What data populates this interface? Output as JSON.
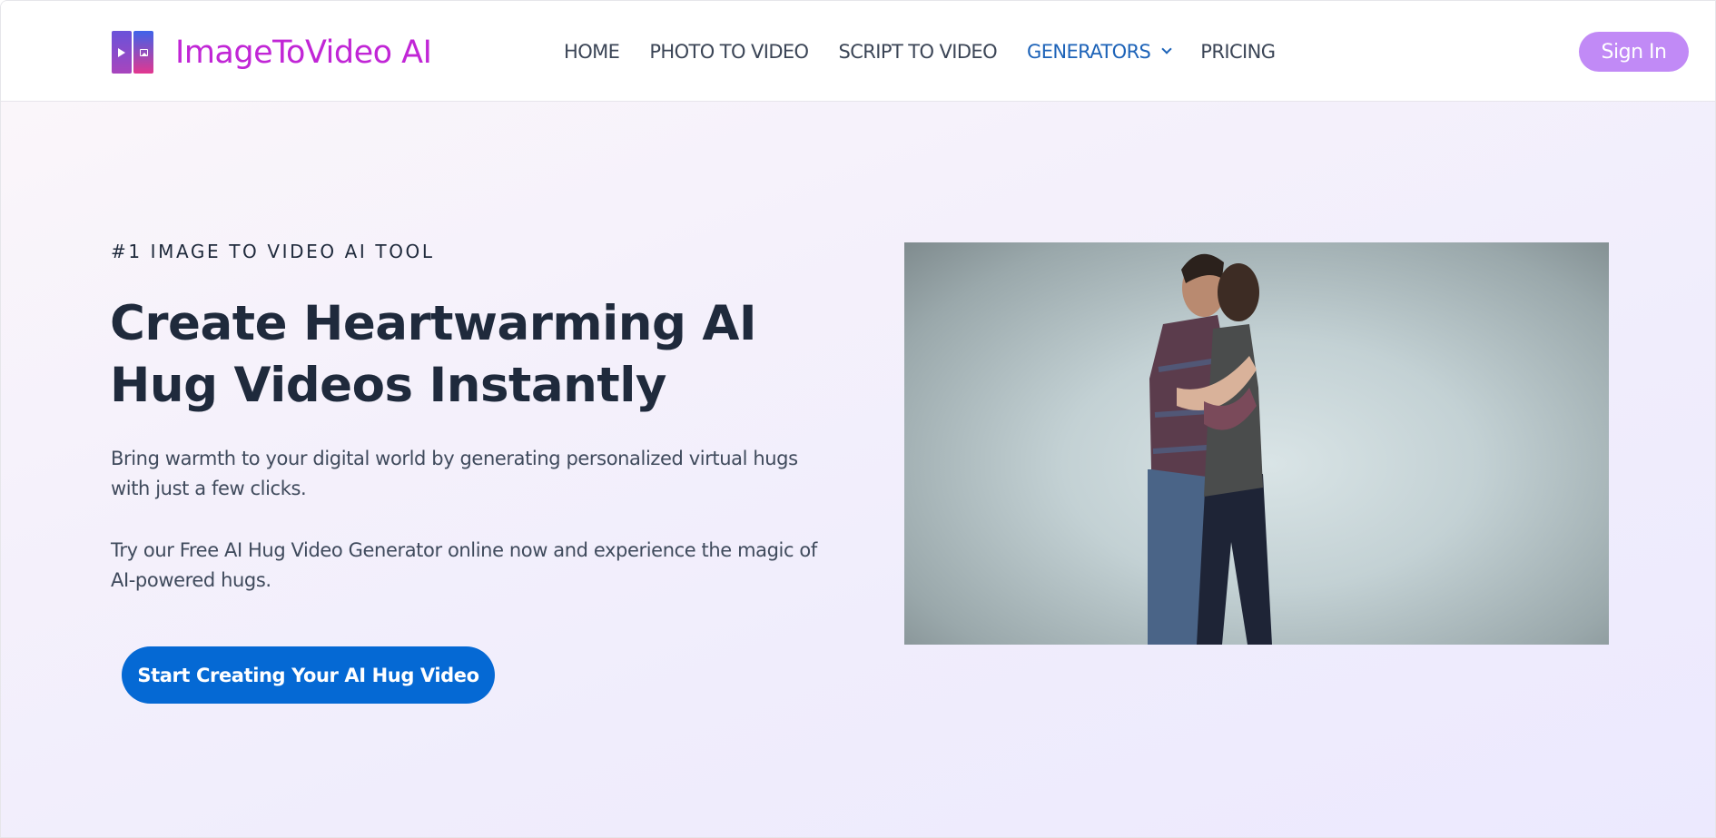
{
  "header": {
    "brand": "ImageToVideo AI",
    "nav": [
      {
        "label": "HOME",
        "active": false
      },
      {
        "label": "PHOTO TO VIDEO",
        "active": false
      },
      {
        "label": "SCRIPT TO VIDEO",
        "active": false
      },
      {
        "label": "GENERATORS",
        "active": true,
        "has_dropdown": true
      },
      {
        "label": "PRICING",
        "active": false
      }
    ],
    "signin_label": "Sign In"
  },
  "hero": {
    "eyebrow": "#1 IMAGE TO VIDEO AI TOOL",
    "title": "Create Heartwarming AI Hug Videos Instantly",
    "paragraph_1": "Bring warmth to your digital world by generating personalized virtual hugs with just a few clicks.",
    "paragraph_2": "Try our Free AI Hug Video Generator online now and experience the magic of AI-powered hugs.",
    "cta_label": "Start Creating Your AI Hug Video",
    "image_alt": "Couple hugging against a grey studio background"
  },
  "colors": {
    "brand": "#c126d6",
    "nav_active": "#1d63b8",
    "nav_text": "#3b4556",
    "signin_bg": "#c18af6",
    "cta_bg": "#0569d4",
    "heading": "#1f2a3c",
    "body_text": "#3f4a5c"
  }
}
